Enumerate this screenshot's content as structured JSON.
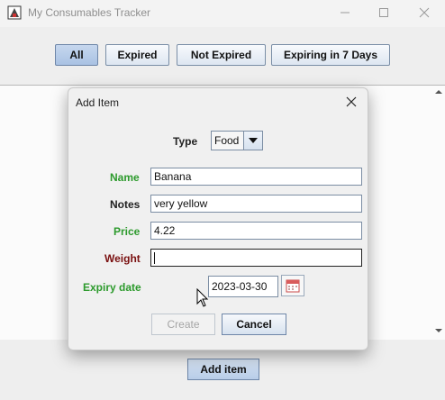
{
  "window": {
    "title": "My Consumables Tracker",
    "icon": "app-icon"
  },
  "filters": [
    {
      "label": "All",
      "active": true
    },
    {
      "label": "Expired",
      "active": false
    },
    {
      "label": "Not Expired",
      "active": false
    },
    {
      "label": "Expiring in 7 Days",
      "active": false
    }
  ],
  "footer": {
    "add_item_label": "Add item"
  },
  "dialog": {
    "title": "Add Item",
    "type": {
      "label": "Type",
      "value": "Food"
    },
    "fields": {
      "name": {
        "label": "Name",
        "value": "Banana",
        "label_color": "#2c9a2c"
      },
      "notes": {
        "label": "Notes",
        "value": "very yellow",
        "label_color": "#222222"
      },
      "price": {
        "label": "Price",
        "value": "4.22",
        "label_color": "#2c9a2c"
      },
      "weight": {
        "label": "Weight",
        "value": "",
        "label_color": "#7a1010"
      },
      "expiry": {
        "label": "Expiry date",
        "value": "2023-03-30",
        "label_color": "#2c9a2c"
      }
    },
    "create_label": "Create",
    "cancel_label": "Cancel"
  },
  "colors": {
    "accent": "#6e86a8",
    "valid_label": "#2c9a2c",
    "invalid_label": "#7a1010"
  }
}
